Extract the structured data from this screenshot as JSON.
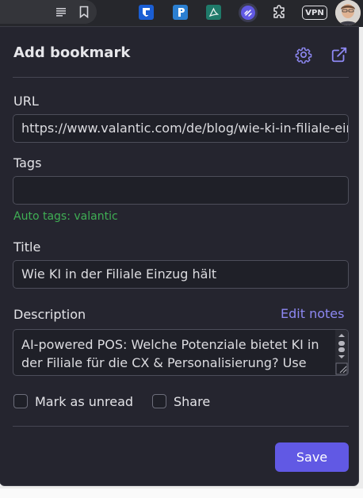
{
  "browser": {
    "vpn_label": "VPN",
    "icons": [
      "reader-icon",
      "bookmark-star-icon",
      "bitwarden-icon",
      "readwise-icon",
      "pdf-icon",
      "linkding-icon",
      "extensions-icon",
      "vpn-icon",
      "profile-avatar"
    ]
  },
  "popup": {
    "title": "Add bookmark",
    "url_label": "URL",
    "url_value": "https://www.valantic.com/de/blog/wie-ki-in-filiale-einzug-haelt/",
    "tags_label": "Tags",
    "tags_value": "",
    "auto_tags": "Auto tags: valantic",
    "title_label": "Title",
    "title_value": "Wie KI in der Filiale Einzug hält",
    "description_label": "Description",
    "edit_notes": "Edit notes",
    "description_value": "AI-powered POS: Welche Potenziale bietet KI in der Filiale für die CX & Personalisierung? Use Cases für den Store & wie hybride Händler",
    "mark_unread_label": "Mark as unread",
    "share_label": "Share",
    "save_label": "Save"
  },
  "colors": {
    "panel_bg": "#25252f",
    "accent": "#6159e4",
    "link": "#8d88f2",
    "auto_tags": "#3fae54"
  }
}
